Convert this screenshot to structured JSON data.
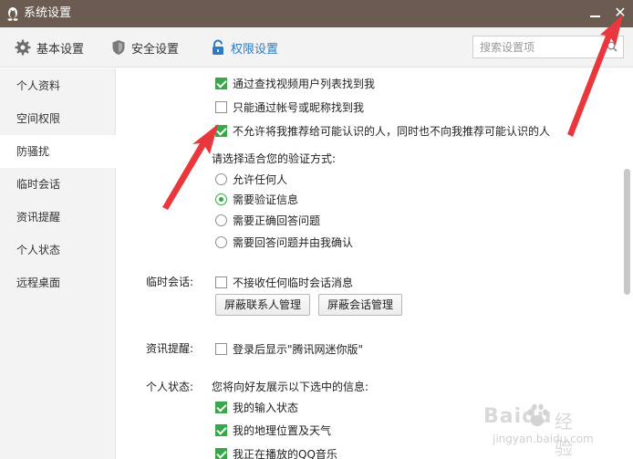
{
  "window": {
    "title": "系统设置",
    "close_glyph": "✕"
  },
  "toolbar": {
    "tabs": [
      {
        "label": "基本设置",
        "icon": "gear-icon"
      },
      {
        "label": "安全设置",
        "icon": "shield-icon"
      },
      {
        "label": "权限设置",
        "icon": "lock-icon",
        "active": true
      }
    ],
    "search_placeholder": "搜索设置项"
  },
  "sidebar": {
    "items": [
      "个人资料",
      "空间权限",
      "防骚扰",
      "临时会话",
      "资讯提醒",
      "个人状态",
      "远程桌面"
    ],
    "active": "防骚扰"
  },
  "antiharass": {
    "options": [
      {
        "label": "通过查找视频用户列表找到我",
        "checked": true
      },
      {
        "label": "只能通过帐号或昵称找到我",
        "checked": false
      },
      {
        "label": "不允许将我推荐给可能认识的人，同时也不向我推荐可能认识的人",
        "checked": true
      }
    ],
    "verify_title": "请选择适合您的验证方式:",
    "verify_options": [
      {
        "label": "允许任何人",
        "checked": false
      },
      {
        "label": "需要验证信息",
        "checked": true
      },
      {
        "label": "需要正确回答问题",
        "checked": false
      },
      {
        "label": "需要回答问题并由我确认",
        "checked": false
      }
    ]
  },
  "temp_session": {
    "label": "临时会话:",
    "option": {
      "label": "不接收任何临时会话消息",
      "checked": false
    },
    "buttons": [
      "屏蔽联系人管理",
      "屏蔽会话管理"
    ]
  },
  "news": {
    "label": "资讯提醒:",
    "option": {
      "label": "登录后显示\"腾讯网迷你版\"",
      "checked": false
    }
  },
  "status": {
    "label": "个人状态:",
    "intro": "您将向好友展示以下选中的信息:",
    "options": [
      {
        "label": "我的输入状态",
        "checked": true
      },
      {
        "label": "我的地理位置及天气",
        "checked": true
      },
      {
        "label": "我正在播放的QQ音乐",
        "checked": true
      }
    ]
  },
  "colors": {
    "titlebar": "#6b5b50",
    "accent": "#2a7cc7",
    "check": "#3aa54a",
    "arrow": "#e8383d"
  },
  "watermark": {
    "brand": "Baidu",
    "sub": "经验",
    "url": "jingyan.baidu.com"
  }
}
